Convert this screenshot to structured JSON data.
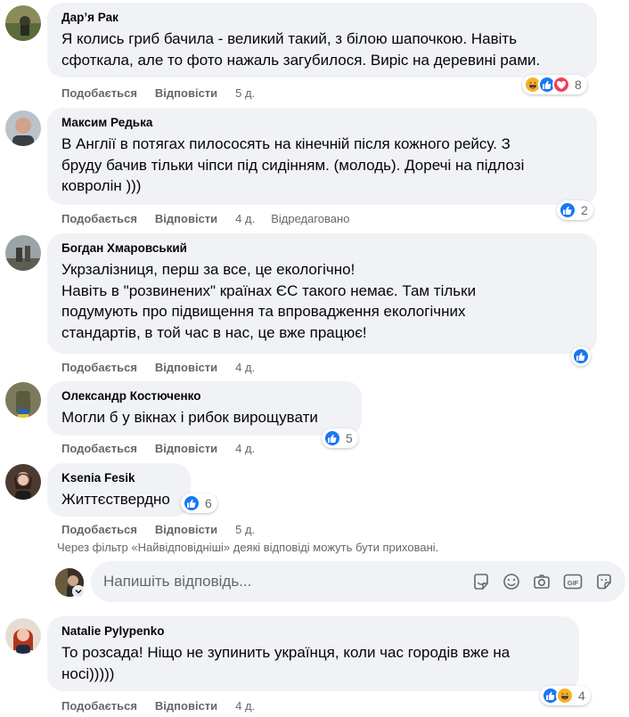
{
  "comments": [
    {
      "author": "Дар’я Рак",
      "lines": [
        "Я колись гриб бачила - великий такий, з білою шапочкою. Навіть",
        "сфоткала, але то фото нажаль загубилося. Виріс на деревині рами."
      ],
      "like_label": "Подобається",
      "reply_label": "Відповісти",
      "time": "5 д.",
      "reaction_icons": [
        "haha-icon",
        "like-icon",
        "love-icon"
      ],
      "reaction_count": "8"
    },
    {
      "author": "Максим Редька",
      "lines": [
        "В Англії в потягах пилососять на кінечній після кожного рейсу. З",
        "бруду бачив тільки чіпси під сидінням. (молодь). Доречі на підлозі",
        "ковролін )))"
      ],
      "like_label": "Подобається",
      "reply_label": "Відповісти",
      "time": "4 д.",
      "edited": "Відредаговано",
      "reaction_icons": [
        "like-icon"
      ],
      "reaction_count": "2"
    },
    {
      "author": "Богдан Хмаровський",
      "lines": [
        "Укрзалізниця, перш за все, це екологічно!",
        "Навіть в \"розвинених\" країнах ЄС такого немає. Там тільки",
        "подумують про підвищення та впровадження екологічних",
        "стандартів, в той час в нас, це вже працює!"
      ],
      "like_label": "Подобається",
      "reply_label": "Відповісти",
      "time": "4 д.",
      "reaction_icons": [
        "like-icon"
      ],
      "reaction_count": ""
    },
    {
      "author": "Олександр Костюченко",
      "lines": [
        "Могли б у вікнах і рибок вирощувати"
      ],
      "like_label": "Подобається",
      "reply_label": "Відповісти",
      "time": "4 д.",
      "reaction_icons": [
        "like-icon"
      ],
      "reaction_count": "5"
    },
    {
      "author": "Ksenia Fesik",
      "lines": [
        "Життєствердно"
      ],
      "like_label": "Подобається",
      "reply_label": "Відповісти",
      "time": "5 д.",
      "reaction_icons": [
        "like-icon"
      ],
      "reaction_count": "6"
    }
  ],
  "filter_notice": "Через фільтр «Найвідповідніші» деякі відповіді можуть бути приховані.",
  "reply": {
    "placeholder": "Напишіть відповідь...",
    "tools": [
      "sticker-face-icon",
      "emoji-icon",
      "camera-icon",
      "gif-icon",
      "sticker-icon"
    ],
    "gif_label": "GIF"
  },
  "last_comment": {
    "author": "Natalie Pylypenko",
    "lines": [
      "То розсада! Ніщо не зупинить українця, коли час городів вже на",
      "носі)))))"
    ],
    "like_label": "Подобається",
    "reply_label": "Відповісти",
    "time": "4 д.",
    "reaction_icons": [
      "like-icon",
      "haha-icon"
    ],
    "reaction_count": "4"
  },
  "colors": {
    "bubble": "#f0f2f5",
    "meta_text": "#65676b",
    "like_blue": "#1877f2",
    "haha_yellow": "#f7b125",
    "love_red": "#f33e58"
  }
}
